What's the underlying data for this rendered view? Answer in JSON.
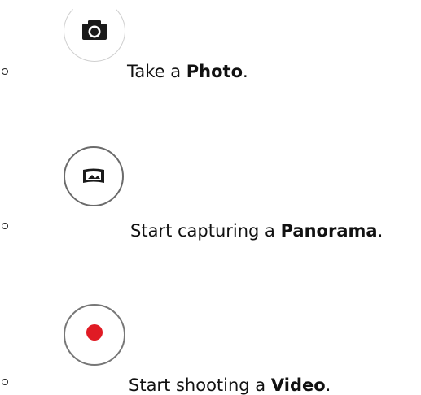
{
  "items": [
    {
      "icon": "camera-icon",
      "prefix": "Take a ",
      "bold": "Photo",
      "suffix": "."
    },
    {
      "icon": "panorama-icon",
      "prefix": "Start capturing a ",
      "bold": "Panorama",
      "suffix": "."
    },
    {
      "icon": "record-icon",
      "prefix": "Start shooting a ",
      "bold": "Video",
      "suffix": "."
    }
  ],
  "colors": {
    "record_red": "#e01b24",
    "icon_dark": "#1a1a1a"
  }
}
